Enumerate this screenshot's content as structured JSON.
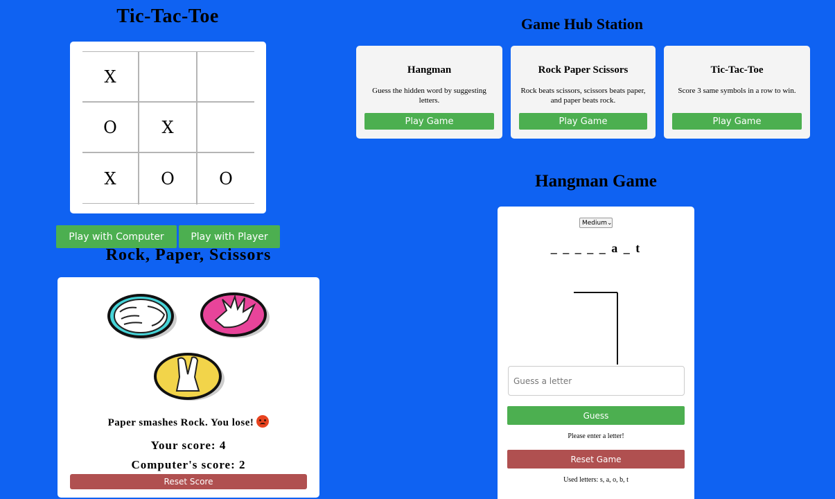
{
  "tictactoe": {
    "title": "Tic-Tac-Toe",
    "board": [
      "X",
      "",
      "",
      "O",
      "X",
      "",
      "X",
      "O",
      "O"
    ],
    "play_computer_label": "Play with Computer",
    "play_player_label": "Play with Player"
  },
  "rps": {
    "title": "Rock, Paper, Scissors",
    "result": "Paper smashes Rock. You lose!",
    "result_emoji": "angry-face",
    "your_score": "Your score: 4",
    "computer_score": "Computer's score: 2",
    "reset_label": "Reset Score",
    "hands": [
      "rock",
      "paper",
      "scissors"
    ]
  },
  "hub": {
    "title": "Game Hub Station",
    "games": [
      {
        "name": "Hangman",
        "desc": "Guess the hidden word by suggesting letters.",
        "button": "Play Game"
      },
      {
        "name": "Rock Paper Scissors",
        "desc": "Rock beats scissors, scissors beats paper, and paper beats rock.",
        "button": "Play Game"
      },
      {
        "name": "Tic-Tac-Toe",
        "desc": "Score 3 same symbols in a row to win.",
        "button": "Play Game"
      }
    ]
  },
  "hangman": {
    "title": "Hangman Game",
    "difficulty": "Medium",
    "word_display": "_ _ _ _ _ a _ t",
    "input_placeholder": "Guess a letter",
    "guess_label": "Guess",
    "message": "Please enter a letter!",
    "reset_label": "Reset Game",
    "used_letters": "Used letters: s, a, o, b, t"
  },
  "colors": {
    "background": "#0f62f2",
    "green": "#4caf50",
    "red": "#b05050"
  }
}
